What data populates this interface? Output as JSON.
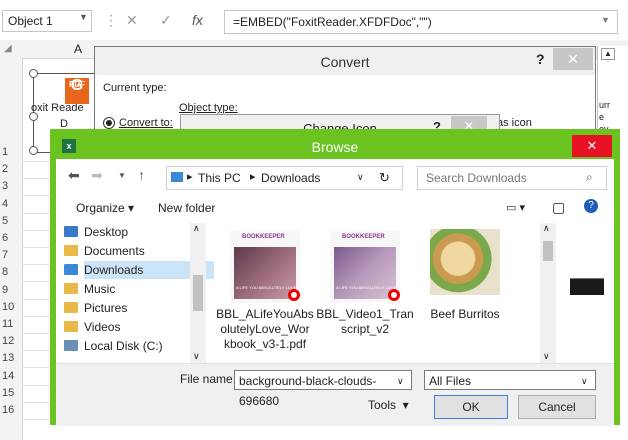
{
  "excel": {
    "name_box": "Object 1",
    "formula": "=EMBED(\"FoxitReader.XFDFDoc\",\"\")",
    "column_a": "A",
    "rows": [
      "1",
      "2",
      "3",
      "4",
      "5",
      "6",
      "7",
      "8",
      "9",
      "10",
      "11",
      "12",
      "13",
      "14",
      "15",
      "16"
    ],
    "object_label_1": "oxit Reade",
    "object_label_2": "D",
    "pdf_text": "PDF",
    "right_pane_text": [
      "urr",
      "e",
      "ov",
      "lov",
      "Mu",
      "ic",
      "id",
      "ooc",
      "ea"
    ]
  },
  "convert": {
    "title": "Convert",
    "help": "?",
    "current_type_label": "Current type:",
    "object_type_label": "Object type:",
    "convert_to_label": "Convert to:",
    "as_icon_label": "as icon"
  },
  "change_icon": {
    "title": "Change Icon",
    "help": "?"
  },
  "browse": {
    "title": "Browse",
    "path": [
      "This PC",
      "Downloads"
    ],
    "search_placeholder": "Search Downloads",
    "organize": "Organize",
    "new_folder": "New folder",
    "sidebar": [
      {
        "label": "Desktop",
        "selected": false
      },
      {
        "label": "Documents",
        "selected": false
      },
      {
        "label": "Downloads",
        "selected": true
      },
      {
        "label": "Music",
        "selected": false
      },
      {
        "label": "Pictures",
        "selected": false
      },
      {
        "label": "Videos",
        "selected": false
      },
      {
        "label": "Local Disk (C:)",
        "selected": false
      }
    ],
    "files": [
      {
        "name_lines": [
          "BBL_ALifeYouAbs",
          "olutelyLove_Wor",
          "kbook_v3-1.pdf"
        ],
        "thumb_brand": "BOOKKEEPER",
        "thumb_caption": "A LIFE YOU ABSOLUTELY LOVE"
      },
      {
        "name_lines": [
          "BBL_Video1_Tran",
          "script_v2"
        ],
        "thumb_brand": "BOOKKEEPER",
        "thumb_caption": "A LIFE YOU ABSOLUTELY LOVE"
      },
      {
        "name_lines": [
          "Beef Burritos"
        ]
      },
      {
        "name_lines": []
      }
    ],
    "file_name_label": "File name:",
    "file_name_value": "background-black-clouds-696680",
    "file_type": "All Files",
    "tools": "Tools",
    "ok": "OK",
    "cancel": "Cancel"
  }
}
